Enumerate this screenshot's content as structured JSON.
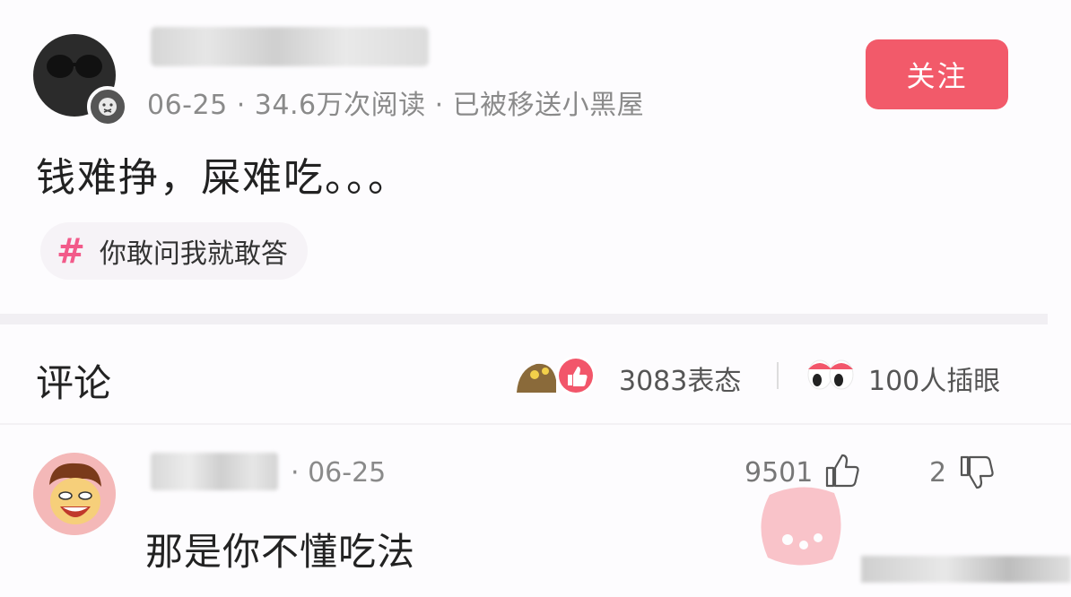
{
  "post": {
    "meta": "06-25 · 34.6万次阅读 · 已被移送小黑屋",
    "follow_label": "关注",
    "text": "钱难挣，屎难吃。。。",
    "topic": "你敢问我就敢答"
  },
  "comments_header": {
    "title": "评论",
    "reactions": "3083表态",
    "eyes": "100人插眼"
  },
  "comment": {
    "date": "· 06-25",
    "likes": "9501",
    "dislikes": "2",
    "text": "那是你不懂吃法"
  },
  "colors": {
    "accent": "#f25a6a",
    "topic_hash": "#f25a8a"
  },
  "icons": [
    "avatar-sunglasses-icon",
    "mute-badge-icon",
    "hashtag-icon",
    "thumbs-up-reaction-icon",
    "eyes-reaction-icon",
    "like-icon",
    "dislike-icon"
  ]
}
